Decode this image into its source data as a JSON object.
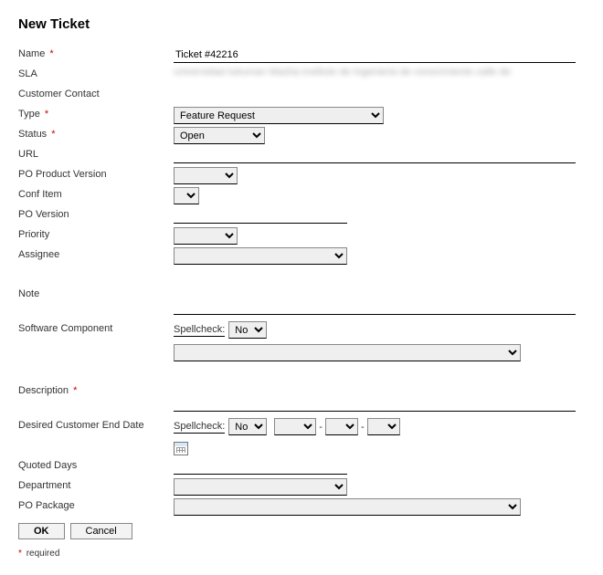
{
  "title": "New Ticket",
  "labels": {
    "name": "Name",
    "sla": "SLA",
    "customer_contact": "Customer Contact",
    "type": "Type",
    "status": "Status",
    "url": "URL",
    "po_product_version": "PO Product Version",
    "conf_item": "Conf Item",
    "po_version": "PO Version",
    "priority": "Priority",
    "assignee": "Assignee",
    "note": "Note",
    "software_component": "Software Component",
    "description": "Description",
    "desired_end_date": "Desired Customer End Date",
    "quoted_days": "Quoted Days",
    "department": "Department",
    "po_package": "PO Package"
  },
  "values": {
    "name": "Ticket #42216",
    "sla_redacted": "universidad tukuman Masha   instituto de ingenieria de conocimiento  calle de",
    "customer_contact": "",
    "type": "Feature Request",
    "status": "Open",
    "url": "",
    "po_product_version": "",
    "conf_item": "",
    "po_version": "",
    "priority": "",
    "assignee": "",
    "note": "",
    "spellcheck_label": "Spellcheck:",
    "spellcheck_value": "No",
    "software_component": "",
    "description": "",
    "date_sep": "-",
    "quoted_days": "",
    "department": "",
    "po_package": ""
  },
  "buttons": {
    "ok": "OK",
    "cancel": "Cancel"
  },
  "footnote": "required",
  "req_mark": "*"
}
